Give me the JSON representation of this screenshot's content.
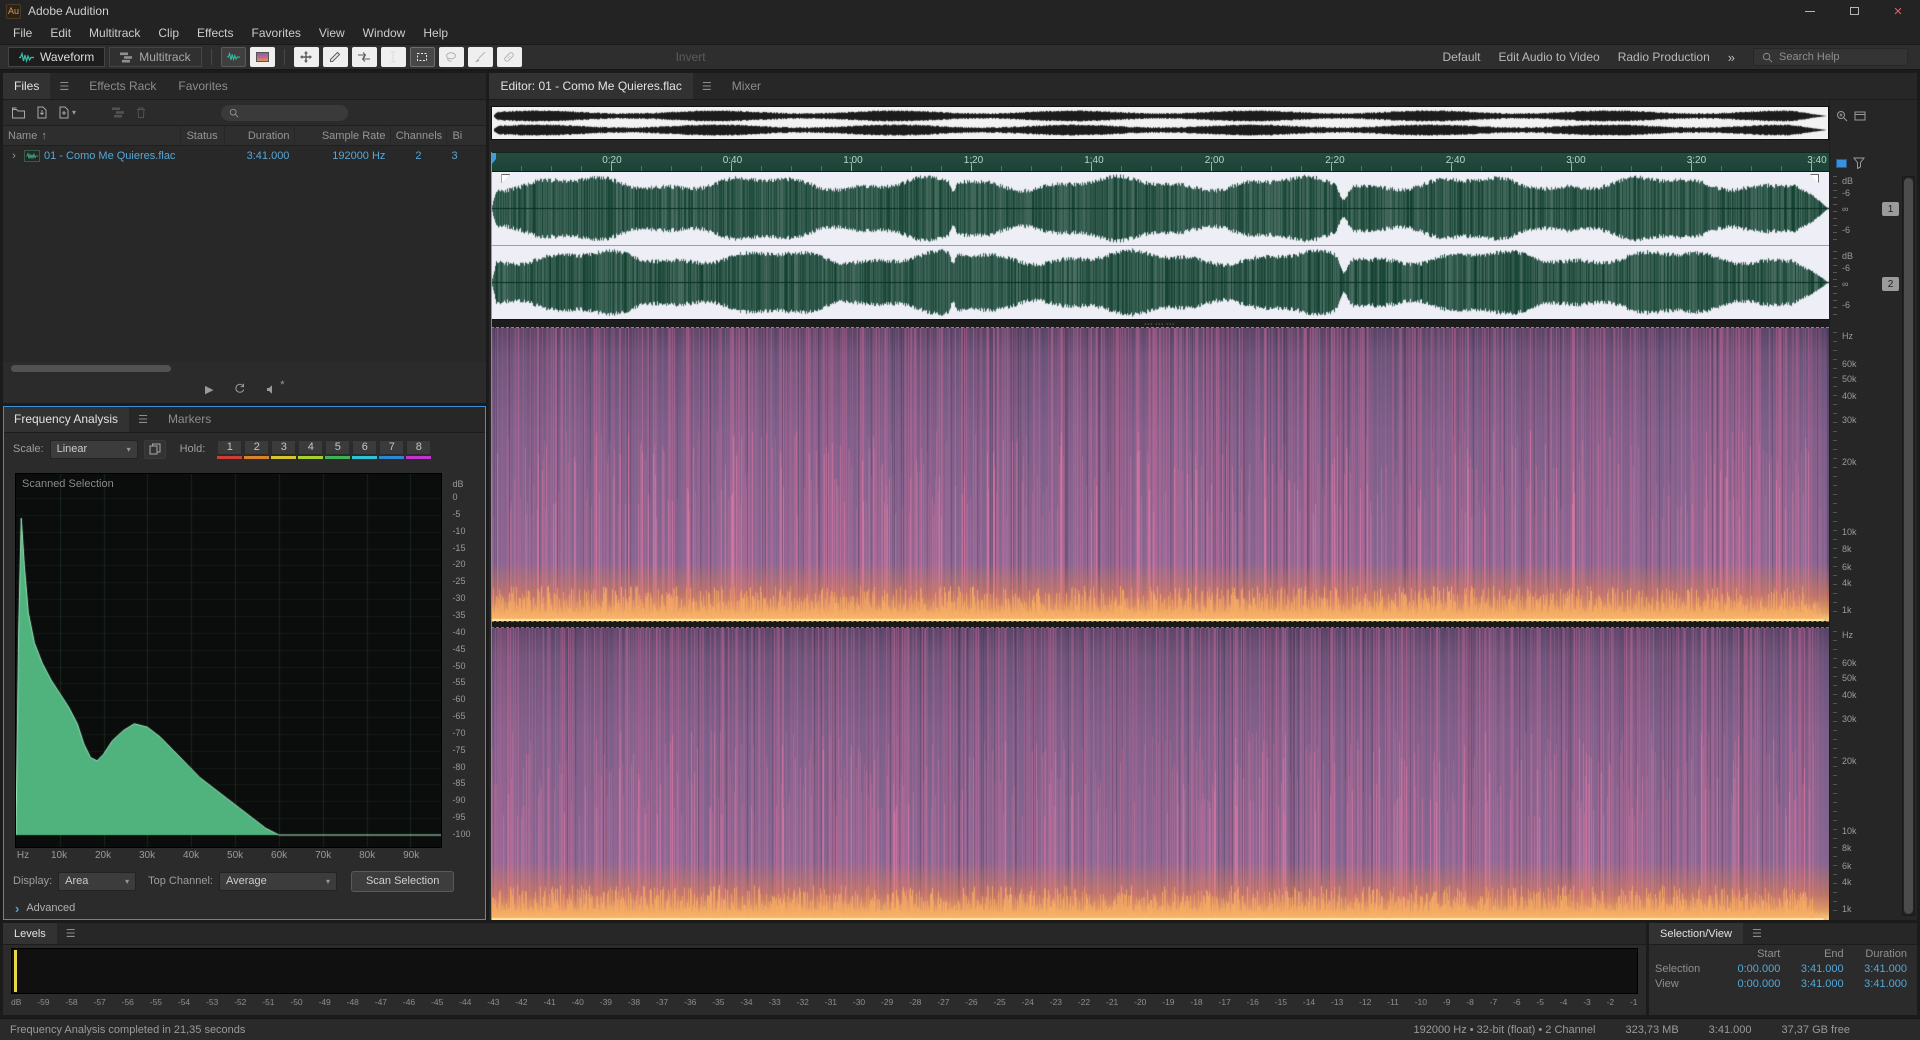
{
  "window": {
    "logo_text": "Au",
    "title": "Adobe Audition",
    "close_glyph": "×"
  },
  "icons": {
    "panel_menu": "☰",
    "caret": "▾",
    "sort_asc": "↑",
    "expander": "›",
    "disclosure": "›",
    "grip": "⋯⋯⋯",
    "play": "▶",
    "asterisk": "*"
  },
  "menu": {
    "items": [
      {
        "label": "File"
      },
      {
        "label": "Edit"
      },
      {
        "label": "Multitrack"
      },
      {
        "label": "Clip"
      },
      {
        "label": "Effects"
      },
      {
        "label": "Favorites"
      },
      {
        "label": "View"
      },
      {
        "label": "Window"
      },
      {
        "label": "Help"
      }
    ]
  },
  "toolbar": {
    "waveform_button": "Waveform",
    "multitrack_button": "Multitrack",
    "invert_button": "Invert",
    "workspace_buttons": [
      {
        "label": "Default"
      },
      {
        "label": "Edit Audio to Video"
      },
      {
        "label": "Radio Production"
      }
    ],
    "overflow_button": "»",
    "search_placeholder": "Search Help"
  },
  "files_panel": {
    "tabs": [
      {
        "label": "Files"
      },
      {
        "label": "Effects Rack"
      },
      {
        "label": "Favorites"
      }
    ],
    "columns": [
      {
        "label": "Name"
      },
      {
        "label": "Status"
      },
      {
        "label": "Duration"
      },
      {
        "label": "Sample Rate"
      },
      {
        "label": "Channels"
      },
      {
        "label": "Bi"
      }
    ],
    "rows": [
      {
        "name": "01 - Como Me Quieres.flac",
        "status": "",
        "duration": "3:41.000",
        "sample_rate": "192000 Hz",
        "channels": "2",
        "bit_depth": "3"
      }
    ]
  },
  "freq_panel": {
    "tabs": [
      {
        "label": "Frequency Analysis"
      },
      {
        "label": "Markers"
      }
    ],
    "scale_label": "Scale:",
    "scale_value": "Linear",
    "hold_label": "Hold:",
    "hold_buttons": [
      {
        "label": "1",
        "color": "#cf3d38"
      },
      {
        "label": "2",
        "color": "#d8832c"
      },
      {
        "label": "3",
        "color": "#d6c62e"
      },
      {
        "label": "4",
        "color": "#a5d32c"
      },
      {
        "label": "5",
        "color": "#3cb457"
      },
      {
        "label": "6",
        "color": "#2fc1d4"
      },
      {
        "label": "7",
        "color": "#2f86d4"
      },
      {
        "label": "8",
        "color": "#c236d0"
      }
    ],
    "graph": {
      "overlay_label": "Scanned Selection",
      "y_unit": "dB",
      "f_max": 97000,
      "y_ticks": [
        "0",
        "-5",
        "-10",
        "-15",
        "-20",
        "-25",
        "-30",
        "-35",
        "-40",
        "-45",
        "-50",
        "-55",
        "-60",
        "-65",
        "-70",
        "-75",
        "-80",
        "-85",
        "-90",
        "-95",
        "-100"
      ],
      "x_ticks": [
        {
          "label": "Hz",
          "v": 0
        },
        {
          "label": "10k",
          "v": 10000
        },
        {
          "label": "20k",
          "v": 20000
        },
        {
          "label": "30k",
          "v": 30000
        },
        {
          "label": "40k",
          "v": 40000
        },
        {
          "label": "50k",
          "v": 50000
        },
        {
          "label": "60k",
          "v": 60000
        },
        {
          "label": "70k",
          "v": 70000
        },
        {
          "label": "80k",
          "v": 80000
        },
        {
          "label": "90k",
          "v": 90000
        }
      ],
      "curve": [
        [
          0,
          -100
        ],
        [
          600,
          -40
        ],
        [
          1200,
          -6
        ],
        [
          1900,
          -20
        ],
        [
          2800,
          -34
        ],
        [
          4200,
          -43
        ],
        [
          6000,
          -49
        ],
        [
          8000,
          -54
        ],
        [
          10000,
          -58
        ],
        [
          12000,
          -62
        ],
        [
          14000,
          -67
        ],
        [
          15500,
          -73
        ],
        [
          17000,
          -77
        ],
        [
          18500,
          -78
        ],
        [
          20000,
          -76
        ],
        [
          22000,
          -72
        ],
        [
          24500,
          -69
        ],
        [
          27000,
          -67
        ],
        [
          30000,
          -68
        ],
        [
          33000,
          -71
        ],
        [
          36000,
          -75
        ],
        [
          39000,
          -79
        ],
        [
          42000,
          -83
        ],
        [
          45000,
          -86
        ],
        [
          48000,
          -89
        ],
        [
          51000,
          -92
        ],
        [
          54000,
          -95
        ],
        [
          57000,
          -98
        ],
        [
          60000,
          -100
        ],
        [
          97000,
          -100
        ]
      ]
    },
    "display_label": "Display:",
    "display_value": "Area",
    "top_channel_label": "Top Channel:",
    "top_channel_value": "Average",
    "scan_button_label": "Scan Selection",
    "advanced_label": "Advanced"
  },
  "editor": {
    "editor_tab": "Editor: 01 - Como Me Quieres.flac",
    "mixer_tab": "Mixer",
    "ruler_total_s": 222,
    "ruler_ticks": [
      {
        "label": "0:20",
        "s": 20
      },
      {
        "label": "0:40",
        "s": 40
      },
      {
        "label": "1:00",
        "s": 60
      },
      {
        "label": "1:20",
        "s": 80
      },
      {
        "label": "1:40",
        "s": 100
      },
      {
        "label": "2:00",
        "s": 120
      },
      {
        "label": "2:20",
        "s": 140
      },
      {
        "label": "2:40",
        "s": 160
      },
      {
        "label": "3:00",
        "s": 180
      },
      {
        "label": "3:20",
        "s": 200
      },
      {
        "label": "3:40",
        "s": 220
      }
    ],
    "amp_ruler": {
      "unit": "dB",
      "labels": [
        {
          "label": "-6",
          "pos": 0.25
        },
        {
          "label": "∞",
          "pos": 0.47
        },
        {
          "label": "-6",
          "pos": 0.76
        }
      ]
    },
    "channel_badges": [
      {
        "label": "1"
      },
      {
        "label": "2"
      }
    ],
    "freq_ruler": {
      "unit": "Hz",
      "labels": [
        {
          "label": "60k",
          "pos": 0.115
        },
        {
          "label": "50k",
          "pos": 0.165
        },
        {
          "label": "40k",
          "pos": 0.225
        },
        {
          "label": "30k",
          "pos": 0.305
        },
        {
          "label": "20k",
          "pos": 0.45
        },
        {
          "label": "10k",
          "pos": 0.69
        },
        {
          "label": "8k",
          "pos": 0.75
        },
        {
          "label": "6k",
          "pos": 0.81
        },
        {
          "label": "4k",
          "pos": 0.865
        },
        {
          "label": "1k",
          "pos": 0.96
        }
      ]
    }
  },
  "levels_panel": {
    "tab": "Levels",
    "scale": [
      "dB",
      "-59",
      "-58",
      "-57",
      "-56",
      "-55",
      "-54",
      "-53",
      "-52",
      "-51",
      "-50",
      "-49",
      "-48",
      "-47",
      "-46",
      "-45",
      "-44",
      "-43",
      "-42",
      "-41",
      "-40",
      "-39",
      "-38",
      "-37",
      "-36",
      "-35",
      "-34",
      "-33",
      "-32",
      "-31",
      "-30",
      "-29",
      "-28",
      "-27",
      "-26",
      "-25",
      "-24",
      "-23",
      "-22",
      "-21",
      "-20",
      "-19",
      "-18",
      "-17",
      "-16",
      "-15",
      "-14",
      "-13",
      "-12",
      "-11",
      "-10",
      "-9",
      "-8",
      "-7",
      "-6",
      "-5",
      "-4",
      "-3",
      "-2",
      "-1"
    ]
  },
  "selection_panel": {
    "tab": "Selection/View",
    "columns": [
      {
        "label": "Start"
      },
      {
        "label": "End"
      },
      {
        "label": "Duration"
      }
    ],
    "rows": [
      {
        "label": "Selection",
        "start": "0:00.000",
        "end": "3:41.000",
        "duration": "3:41.000"
      },
      {
        "label": "View",
        "start": "0:00.000",
        "end": "3:41.000",
        "duration": "3:41.000"
      }
    ]
  },
  "status_bar": {
    "message": "Frequency Analysis completed in 21,35 seconds",
    "format_info": "192000 Hz • 32-bit (float) • 2 Channel",
    "file_size": "323,73 MB",
    "total_duration": "3:41.000",
    "free_space": "37,37 GB free"
  }
}
